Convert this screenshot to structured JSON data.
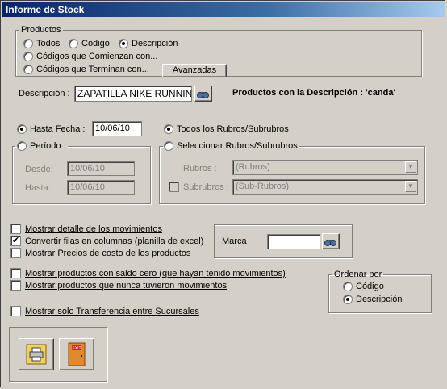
{
  "window": {
    "title": "Informe de Stock"
  },
  "productos": {
    "legend": "Productos",
    "opt_todos": "Todos",
    "opt_codigo": "Código",
    "opt_descripcion": "Descripción",
    "opt_comienzan": "Códigos que Comienzan con...",
    "opt_terminan": "Códigos que Terminan con...",
    "avanzadas": "Avanzadas",
    "selected": "Descripción"
  },
  "descripcion": {
    "label": "Descripción :",
    "value": "ZAPATILLA NIKE RUNNING",
    "info": "Productos con la Descripción : 'canda'",
    "search_icon": "binoculars-icon"
  },
  "fecha": {
    "hasta_label": "Hasta Fecha :",
    "hasta_value": "10/06/10",
    "periodo_label": "Período :",
    "desde_label": "Desde:",
    "desde_value": "10/06/10",
    "hasta2_label": "Hasta:",
    "hasta2_value": "10/06/10",
    "selected": "Hasta Fecha"
  },
  "rubros": {
    "todos_label": "Todos los Rubros/Subrubros",
    "seleccionar_label": "Seleccionar Rubros/Subrubros",
    "rubros_label": "Rubros :",
    "rubros_value": "(Rubros)",
    "subrubros_label": "Subrubros :",
    "subrubros_value": "(Sub-Rubros)",
    "selected": "Todos los Rubros/Subrubros"
  },
  "options": {
    "detalle": "Mostrar detalle de los movimientos",
    "convertir": "Convertir filas en columnas (planilla de excel)",
    "precios": "Mostrar Precios de costo de los productos",
    "saldo_cero": "Mostrar productos con saldo cero (que hayan tenido movimientos)",
    "nunca": "Mostrar productos que nunca tuvieron movimientos",
    "transferencia": "Mostrar solo Transferencia entre Sucursales",
    "checked_convertir": "✔"
  },
  "marca": {
    "label": "Marca",
    "value": "",
    "search_icon": "binoculars-icon"
  },
  "ordenar": {
    "legend": "Ordenar por",
    "codigo": "Código",
    "descripcion": "Descripción",
    "selected": "Descripción"
  },
  "buttons": {
    "print_icon": "printer-icon",
    "exit_icon": "exit-door-icon",
    "exit_text": "EXIT"
  }
}
